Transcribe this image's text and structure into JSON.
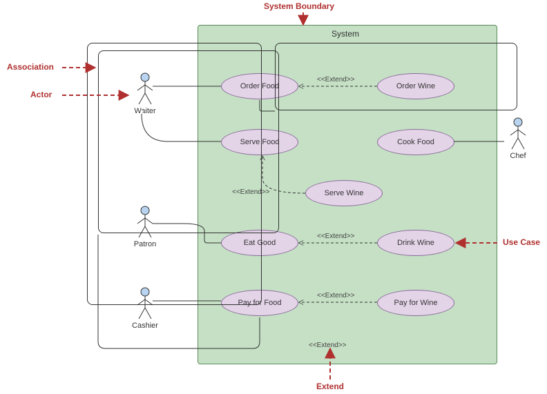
{
  "system": {
    "label": "System"
  },
  "actors": {
    "waiter": "Waiter",
    "patron": "Patron",
    "cashier": "Cashier",
    "chef": "Chef"
  },
  "usecases": {
    "orderFood": "Order Food",
    "orderWine": "Order Wine",
    "serveFood": "Serve Food",
    "cookFood": "Cook Food",
    "serveWine": "Serve Wine",
    "eatGood": "Eat Good",
    "drinkWine": "Drink Wine",
    "payFood": "Pay for Food",
    "payWine": "Pay for Wine"
  },
  "stereotypes": {
    "extend": "<<Extend>>"
  },
  "callouts": {
    "systemBoundary": "System Boundary",
    "association": "Association",
    "actor": "Actor",
    "useCase": "Use Case",
    "extend": "Extend"
  },
  "chart_data": {
    "type": "use-case-diagram",
    "title": "System",
    "actors": [
      "Waiter",
      "Patron",
      "Cashier",
      "Chef"
    ],
    "use_cases": [
      "Order Food",
      "Order Wine",
      "Serve Food",
      "Cook Food",
      "Serve Wine",
      "Eat Good",
      "Drink Wine",
      "Pay for Food",
      "Pay for Wine"
    ],
    "associations": [
      [
        "Waiter",
        "Order Food"
      ],
      [
        "Waiter",
        "Serve Food"
      ],
      [
        "Waiter",
        "Pay for Food"
      ],
      [
        "Patron",
        "Order Food"
      ],
      [
        "Patron",
        "Eat Good"
      ],
      [
        "Patron",
        "Pay for Food"
      ],
      [
        "Cashier",
        "Pay for Food"
      ],
      [
        "Chef",
        "Order Food"
      ],
      [
        "Chef",
        "Cook Food"
      ]
    ],
    "extends": [
      [
        "Order Wine",
        "Order Food"
      ],
      [
        "Serve Wine",
        "Serve Food"
      ],
      [
        "Drink Wine",
        "Eat Good"
      ],
      [
        "Pay for Wine",
        "Pay for Food"
      ]
    ],
    "annotations": [
      "System Boundary",
      "Association",
      "Actor",
      "Use Case",
      "Extend"
    ]
  }
}
